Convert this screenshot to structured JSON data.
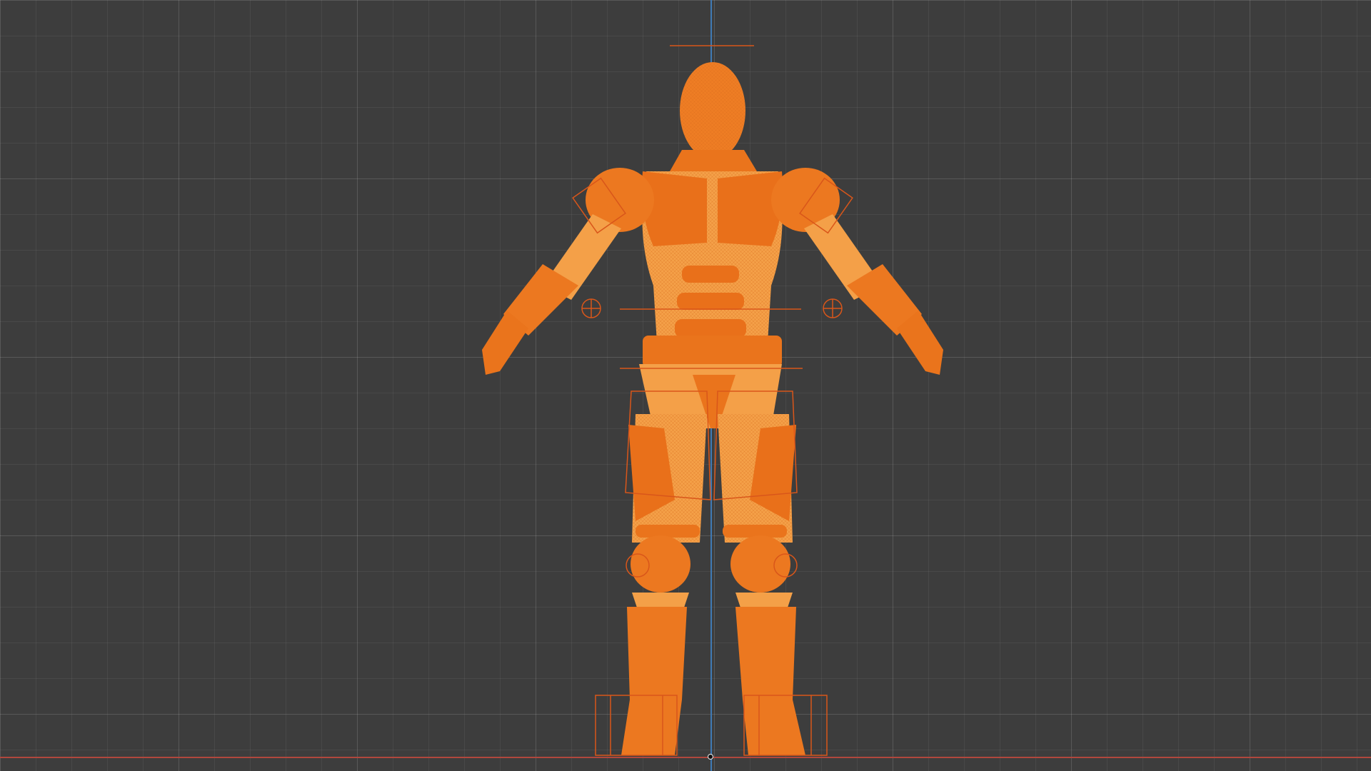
{
  "viewport": {
    "mode": "front-orthographic",
    "colors": {
      "background": "#3d3d3d",
      "grid_minor": "#474747",
      "grid_major": "#4f4f4f",
      "axis_x": "#b0473d",
      "axis_z": "#3f7ab5",
      "selection": "#e8650f",
      "selection_fill": "#f29a3f",
      "rig_outline": "#d9561a"
    }
  },
  "scene": {
    "object": "armored-humanoid-mesh",
    "pose": "a-pose",
    "selected": true,
    "display": "wireframe-overlay",
    "rig_widgets": [
      "head-control-icon",
      "shoulder-control-left-icon",
      "shoulder-control-right-icon",
      "hand-control-left-icon",
      "hand-control-right-icon",
      "torso-control-icon",
      "hip-control-icon",
      "knee-control-left-icon",
      "knee-control-right-icon",
      "foot-control-left-icon",
      "foot-control-right-icon"
    ]
  }
}
